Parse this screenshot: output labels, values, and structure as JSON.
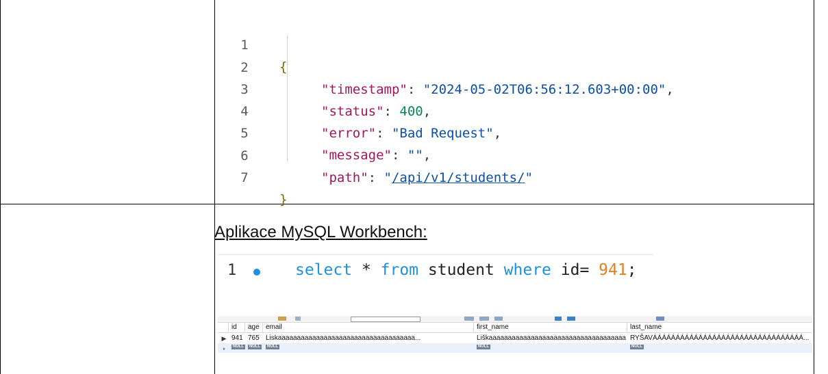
{
  "json_response": {
    "line_numbers": [
      "1",
      "2",
      "3",
      "4",
      "5",
      "6",
      "7"
    ],
    "open_brace": "{",
    "close_brace": "}",
    "fields": [
      {
        "key": "\"timestamp\"",
        "value": "\"2024-05-02T06:56:12.603+00:00\"",
        "trail": ","
      },
      {
        "key": "\"status\"",
        "value": "400",
        "trail": ","
      },
      {
        "key": "\"error\"",
        "value": "\"Bad Request\"",
        "trail": ","
      },
      {
        "key": "\"message\"",
        "value": "\"\"",
        "trail": ","
      },
      {
        "key": "\"path\"",
        "value_quote_open": "\"",
        "value_link": "/api/v1/students/",
        "value_quote_close": "\"",
        "trail": ""
      }
    ]
  },
  "mysql": {
    "caption": "Aplikace MySQL Workbench:",
    "query_line_number": "1",
    "query": {
      "select": "select",
      "star": " * ",
      "from": "from",
      "table": " student ",
      "where": "where",
      "cond": " id= ",
      "value": "941",
      "end": ";"
    },
    "result": {
      "columns": [
        "id",
        "age",
        "email",
        "first_name",
        "last_name"
      ],
      "rows": [
        {
          "marker": "▶",
          "id": "941",
          "age": "765",
          "email": "Liskaaaaaaaaaaaaaaaaaaaaaaaaaaaaaaaaaaaa...",
          "first_name": "Liškaaaaaaaaaaaaaaaaaaaaaaaaaaaaaaaaaaaa...",
          "last_name": "RYŠAVÁÁÁÁÁÁÁÁÁÁÁÁÁÁÁÁÁÁÁÁÁÁÁÁÁÁÁÁÁÁÁÁÁ..."
        }
      ],
      "null_label": "NULL",
      "new_row_marker": "*"
    }
  }
}
